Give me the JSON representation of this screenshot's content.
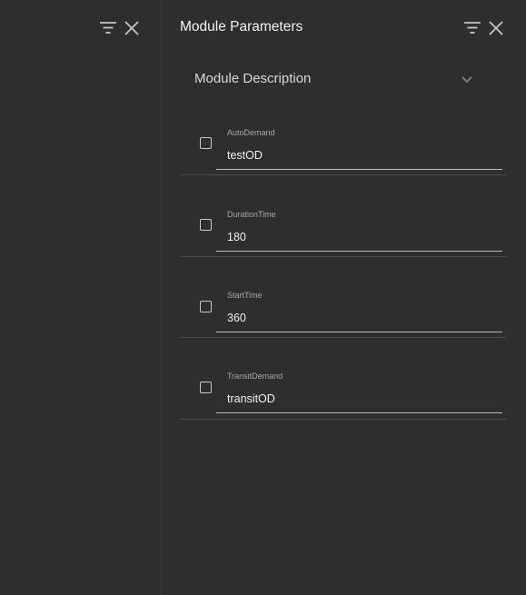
{
  "panel": {
    "title": "Module Parameters",
    "expansion": {
      "title": "Module Description",
      "chevron_icon": "chevron-down-icon"
    },
    "icons": {
      "filter": "filter-icon",
      "close": "close-icon"
    }
  },
  "parameters": [
    {
      "label": "AutoDemand",
      "value": "testOD",
      "checked": false
    },
    {
      "label": "DurationTime",
      "value": "180",
      "checked": false
    },
    {
      "label": "StartTime",
      "value": "360",
      "checked": false
    },
    {
      "label": "TransitDemand",
      "value": "transitOD",
      "checked": false
    }
  ],
  "colors": {
    "background": "#2e2e2e",
    "text": "#f2f2f2",
    "muted": "#a8a8a8",
    "divider": "#4a4a4a",
    "icon": "#c8c8c8"
  }
}
